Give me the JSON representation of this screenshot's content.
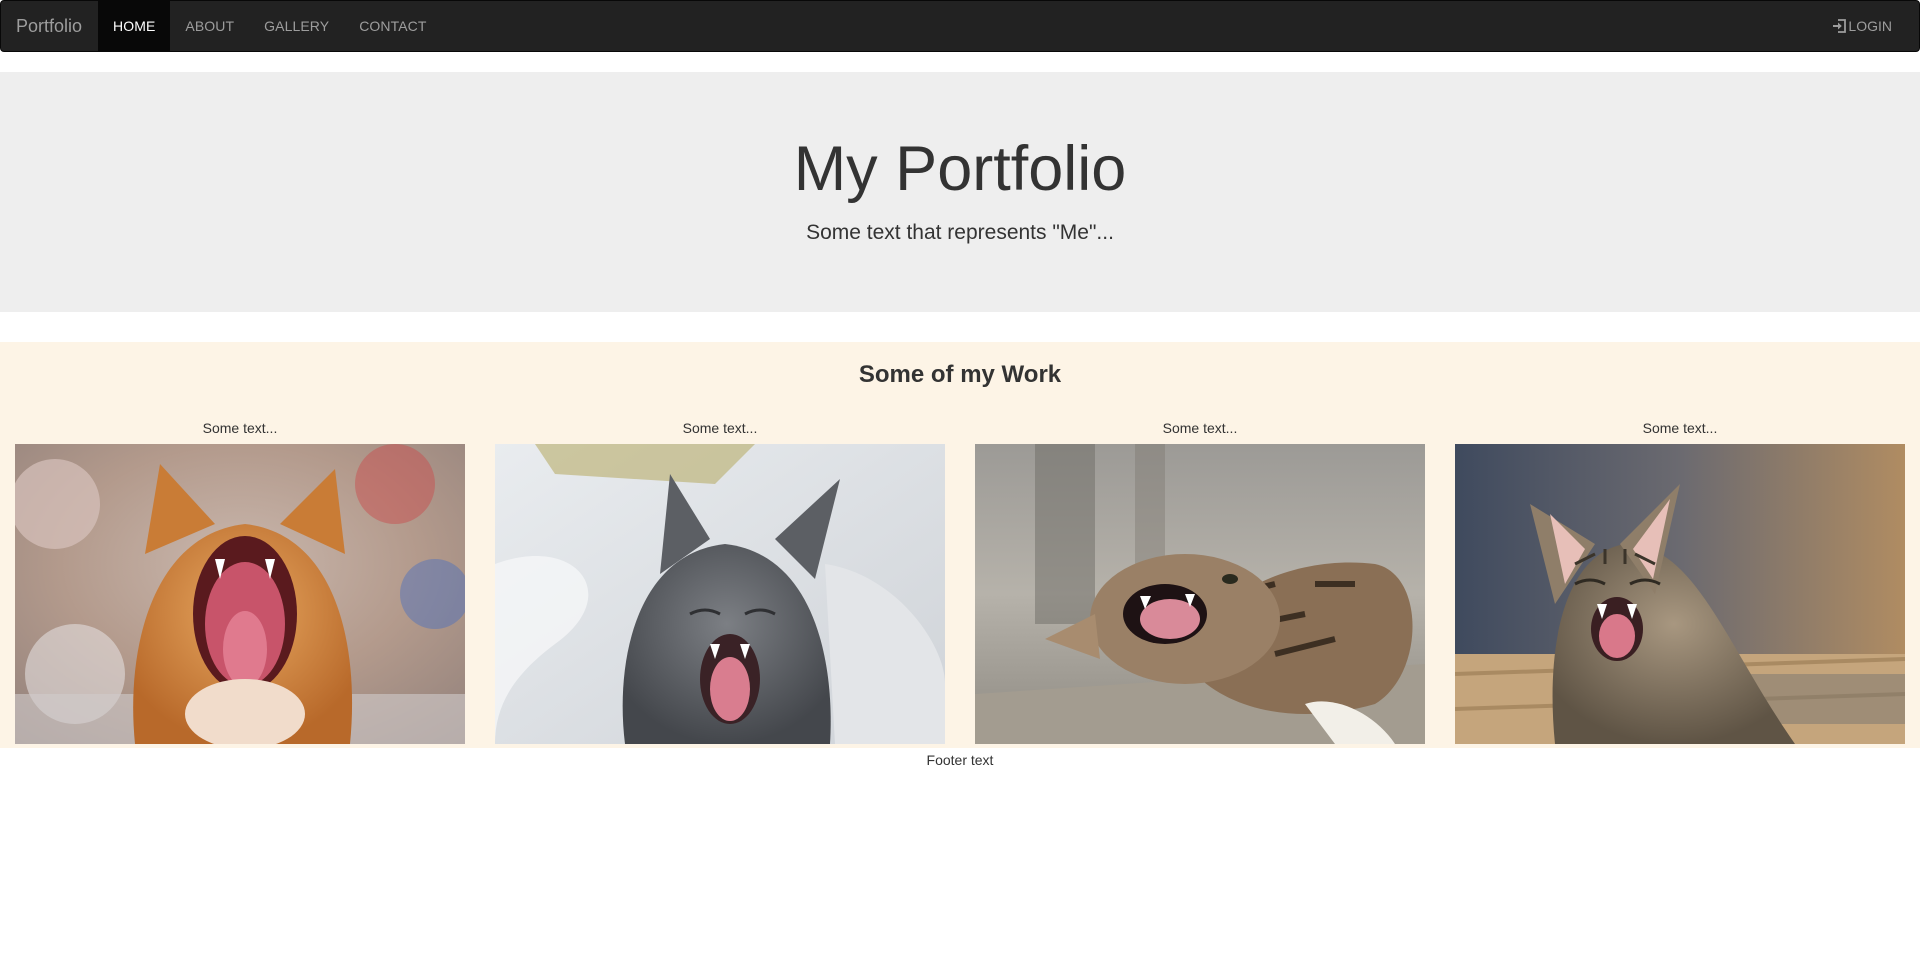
{
  "navbar": {
    "brand": "Portfolio",
    "links": [
      {
        "label": "HOME",
        "active": true
      },
      {
        "label": "ABOUT",
        "active": false
      },
      {
        "label": "GALLERY",
        "active": false
      },
      {
        "label": "CONTACT",
        "active": false
      }
    ],
    "login_label": "LOGIN",
    "login_icon": "log-in-icon"
  },
  "jumbotron": {
    "title": "My Portfolio",
    "subtitle": "Some text that represents \"Me\"..."
  },
  "work": {
    "title": "Some of my Work",
    "cards": [
      {
        "text": "Some text...",
        "image": "orange-cat-yawning-photo"
      },
      {
        "text": "Some text...",
        "image": "gray-cat-yawning-photo"
      },
      {
        "text": "Some text...",
        "image": "tabby-cat-lying-yawning-photo"
      },
      {
        "text": "Some text...",
        "image": "tabby-kitten-yawning-photo"
      }
    ]
  },
  "footer": {
    "text": "Footer text"
  },
  "colors": {
    "navbar_bg": "#222222",
    "navbar_active_bg": "#080808",
    "navbar_text": "#9d9d9d",
    "jumbotron_bg": "#eeeeee",
    "work_bg": "#fdf4e6",
    "text": "#333333"
  }
}
